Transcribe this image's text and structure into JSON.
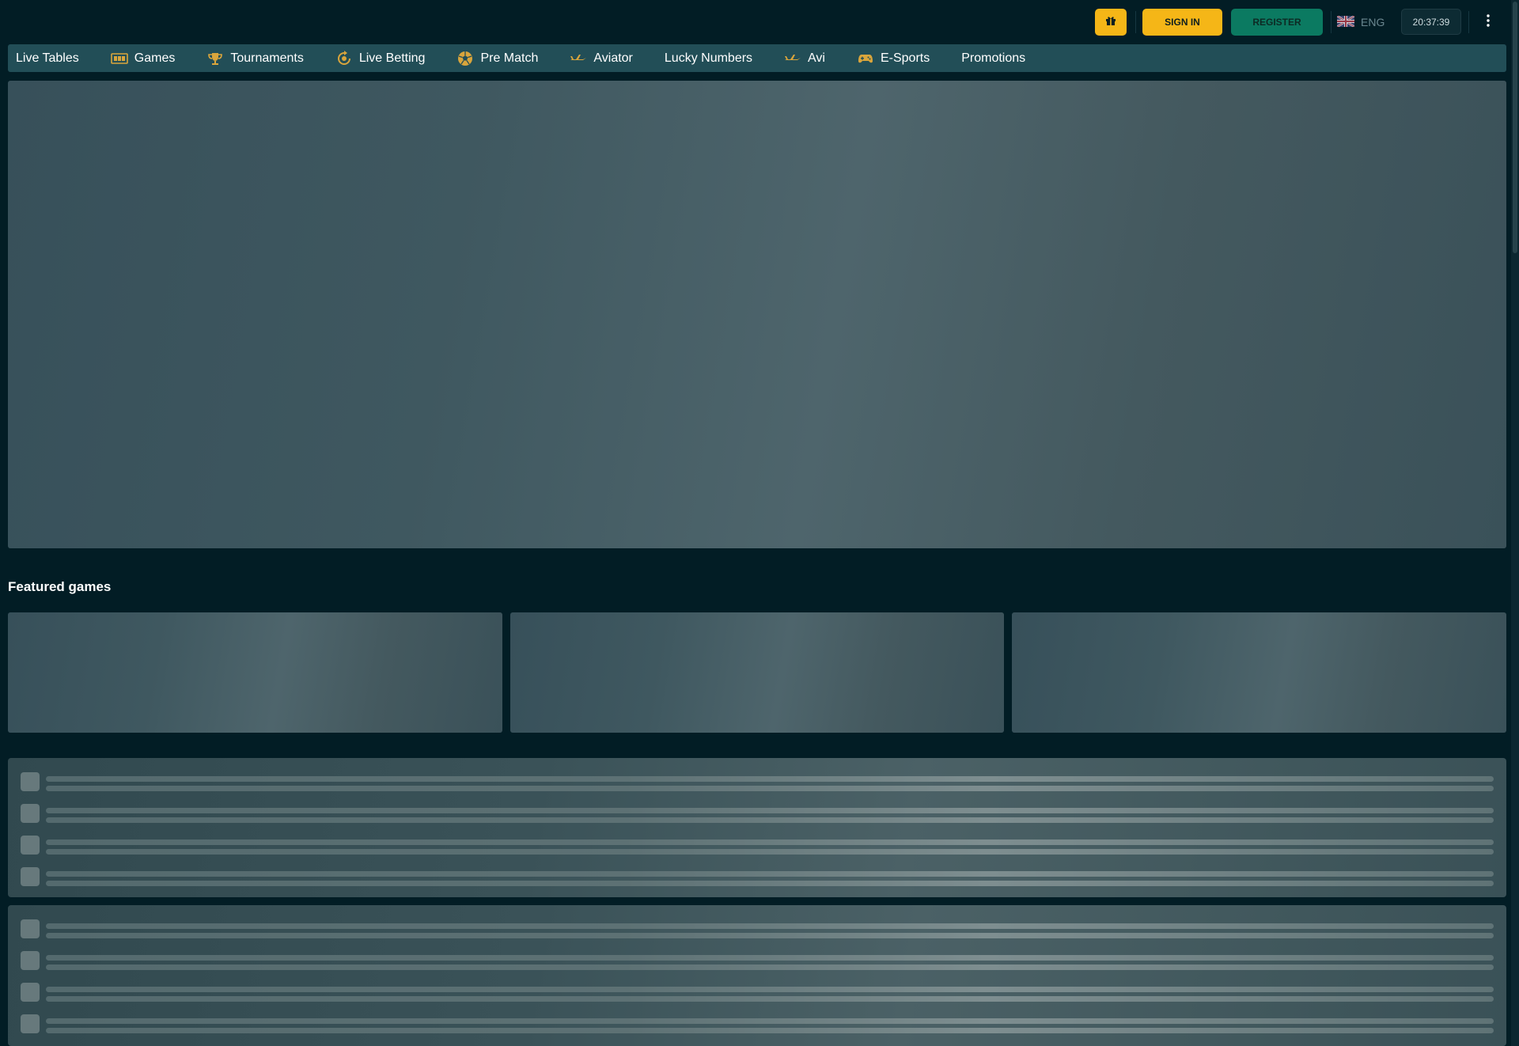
{
  "header": {
    "gift_icon": "gift-icon",
    "sign_in_label": "SIGN IN",
    "register_label": "REGISTER",
    "language": {
      "flag_icon": "uk-flag-icon",
      "label": "ENG"
    },
    "clock": "20:37:39",
    "menu_icon": "kebab-menu-icon"
  },
  "nav": {
    "items": [
      {
        "label": "Live Tables",
        "icon": null
      },
      {
        "label": "Games",
        "icon": "slot-machine-icon"
      },
      {
        "label": "Tournaments",
        "icon": "trophy-icon"
      },
      {
        "label": "Live Betting",
        "icon": "live-icon"
      },
      {
        "label": "Pre Match",
        "icon": "soccer-ball-icon"
      },
      {
        "label": "Aviator",
        "icon": "airplane-icon"
      },
      {
        "label": "Lucky Numbers",
        "icon": null
      },
      {
        "label": "Avi",
        "icon": "airplane-icon"
      },
      {
        "label": "E-Sports",
        "icon": "gamepad-icon"
      },
      {
        "label": "Promotions",
        "icon": null
      }
    ]
  },
  "featured": {
    "title": "Featured games"
  },
  "colors": {
    "background": "#021d25",
    "accent_yellow": "#f5b617",
    "register_green": "#0b7a61",
    "nav_bg": "#224e57",
    "icon_gold": "#d9a53c"
  }
}
